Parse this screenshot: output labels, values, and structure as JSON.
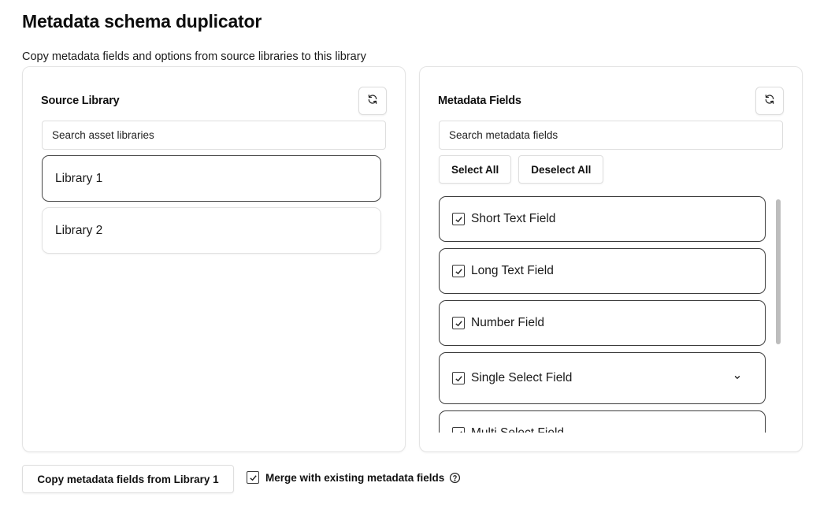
{
  "page": {
    "title": "Metadata schema duplicator",
    "subtitle": "Copy metadata fields and options from source libraries to this library"
  },
  "source_panel": {
    "title": "Source Library",
    "refresh_icon": "refresh-icon",
    "search_placeholder": "Search asset libraries",
    "libraries": [
      {
        "label": "Library 1",
        "selected": true
      },
      {
        "label": "Library 2",
        "selected": false
      }
    ]
  },
  "fields_panel": {
    "title": "Metadata Fields",
    "refresh_icon": "refresh-icon",
    "search_placeholder": "Search metadata fields",
    "select_all_label": "Select All",
    "deselect_all_label": "Deselect All",
    "fields": [
      {
        "label": "Short Text Field",
        "checked": true
      },
      {
        "label": "Long Text Field",
        "checked": true
      },
      {
        "label": "Number Field",
        "checked": true
      },
      {
        "label": "Single Select Field",
        "checked": true,
        "expandable": true
      },
      {
        "label": "Multi Select Field",
        "checked": true
      }
    ]
  },
  "footer": {
    "copy_button_label": "Copy metadata fields from Library 1",
    "merge_label": "Merge with existing metadata fields",
    "merge_checked": true,
    "help_icon": "help-circle-icon"
  },
  "colors": {
    "selected_border": "#4a4a4a",
    "field_border": "#3c3c3c",
    "panel_border": "#e4e4e4"
  }
}
